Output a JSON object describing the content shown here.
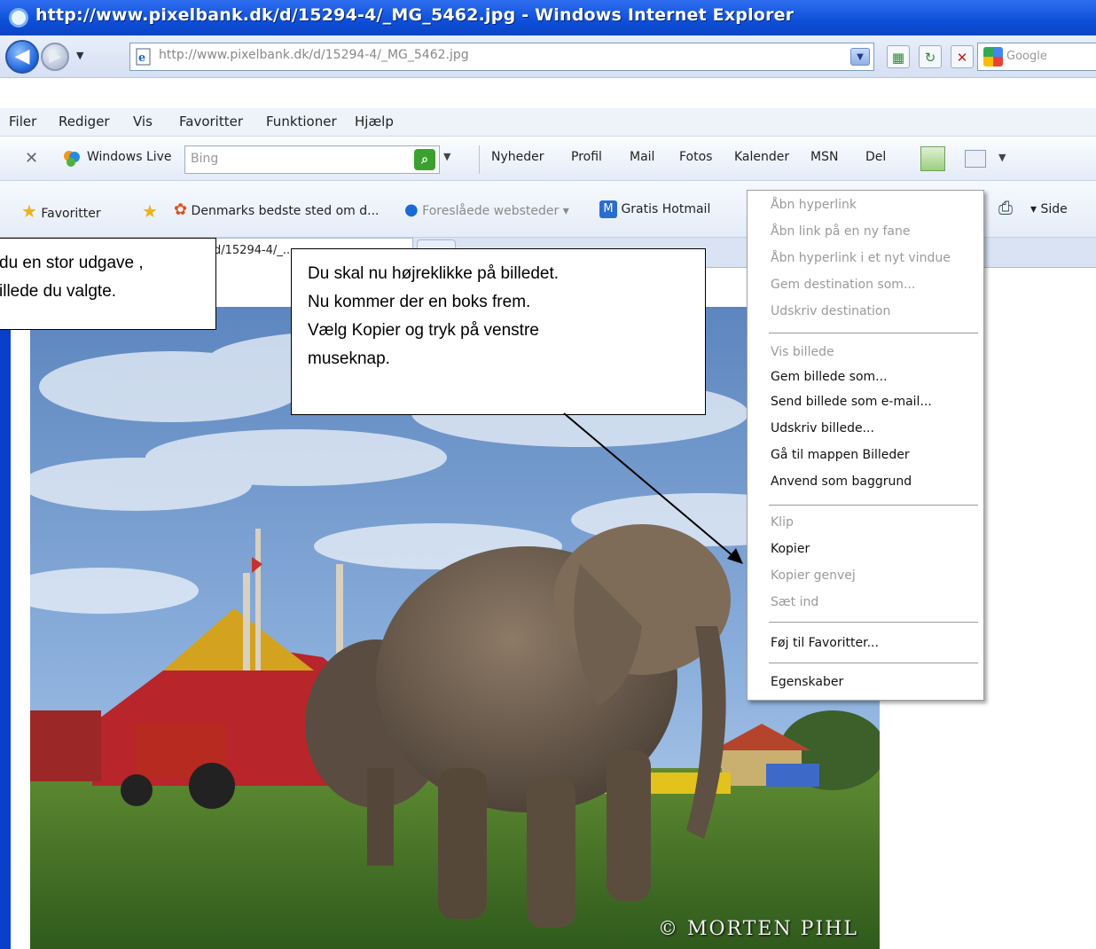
{
  "window": {
    "title": "http://www.pixelbank.dk/d/15294-4/_MG_5462.jpg - Windows Internet Explorer"
  },
  "address_bar": {
    "url": "http://www.pixelbank.dk/d/15294-4/_MG_5462.jpg",
    "search_engine": "Google"
  },
  "menu": [
    "Filer",
    "Rediger",
    "Vis",
    "Favoritter",
    "Funktioner",
    "Hjælp"
  ],
  "live_toolbar": {
    "brand": "Windows Live",
    "search_placeholder": "Bing",
    "links": [
      "Nyheder",
      "Profil",
      "Mail",
      "Fotos",
      "Kalender",
      "MSN",
      "Del"
    ]
  },
  "favorites_bar": {
    "favorites_label": "Favoritter",
    "items": [
      "Denmarks bedste sted om d...",
      "Foreslåede websteder ▾",
      "Gratis Hotmail"
    ],
    "page_label": "Side"
  },
  "tab": {
    "title": "d/15294-4/_..."
  },
  "photo": {
    "watermark": "© MORTEN PIHL"
  },
  "context_menu": {
    "groups": [
      [
        {
          "label": "Åbn hyperlink",
          "enabled": false
        },
        {
          "label": "Åbn link på en ny fane",
          "enabled": false
        },
        {
          "label": "Åbn hyperlink i et nyt vindue",
          "enabled": false
        },
        {
          "label": "Gem destination som...",
          "enabled": false
        },
        {
          "label": "Udskriv destination",
          "enabled": false
        }
      ],
      [
        {
          "label": "Vis billede",
          "enabled": false
        },
        {
          "label": "Gem billede som...",
          "enabled": true
        },
        {
          "label": "Send billede som e-mail...",
          "enabled": true
        },
        {
          "label": "Udskriv billede...",
          "enabled": true
        },
        {
          "label": "Gå til mappen Billeder",
          "enabled": true
        },
        {
          "label": "Anvend som baggrund",
          "enabled": true
        }
      ],
      [
        {
          "label": "Klip",
          "enabled": false
        },
        {
          "label": "Kopier",
          "enabled": true
        },
        {
          "label": "Kopier genvej",
          "enabled": false
        },
        {
          "label": "Sæt ind",
          "enabled": false
        }
      ],
      [
        {
          "label": "Føj til Favoritter...",
          "enabled": true
        }
      ],
      [
        {
          "label": "Egenskaber",
          "enabled": true
        }
      ]
    ]
  },
  "callouts": {
    "left": [
      "du en stor udgave ,",
      "illede du valgte."
    ],
    "main": [
      "Du skal nu højreklikke på billedet.",
      "Nu kommer der en boks frem.",
      "Vælg Kopier og tryk på venstre",
      "museknap."
    ]
  },
  "colors": {
    "titlebar": "#0e4fd8",
    "frame": "#0a3fc9",
    "menu_disabled": "#9a9a9a"
  }
}
